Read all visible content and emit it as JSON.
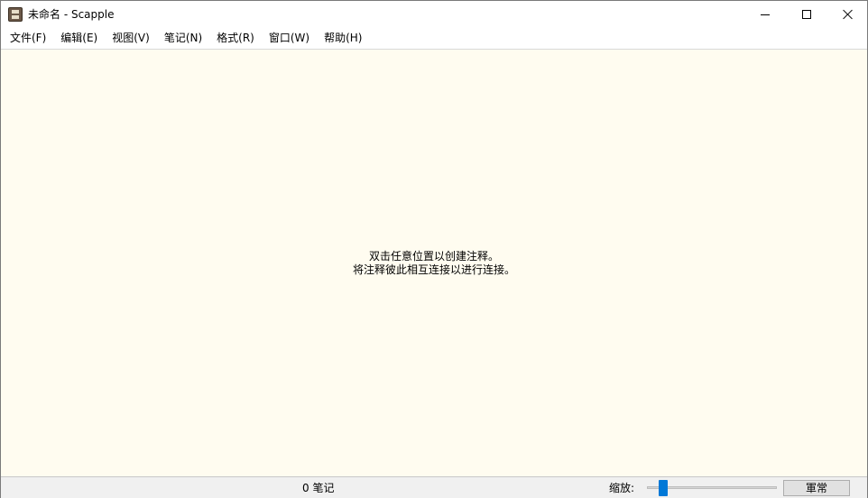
{
  "window": {
    "title": "未命名 - Scapple",
    "icon": "scapple-app-icon",
    "controls": {
      "minimize": "minimize-icon",
      "maximize": "maximize-icon",
      "close": "close-icon"
    }
  },
  "menu": [
    {
      "label": "文件(F)"
    },
    {
      "label": "编辑(E)"
    },
    {
      "label": "视图(V)"
    },
    {
      "label": "笔记(N)"
    },
    {
      "label": "格式(R)"
    },
    {
      "label": "窗口(W)"
    },
    {
      "label": "帮助(H)"
    }
  ],
  "canvas": {
    "background": "#fffcf0",
    "hint_line1": "双击任意位置以创建注释。",
    "hint_line2": "将注释彼此相互连接以进行连接。"
  },
  "status": {
    "note_count": "0 笔记",
    "zoom_label": "缩放:",
    "actual_size_label": "軍常",
    "slider_color": "#0078d7"
  }
}
